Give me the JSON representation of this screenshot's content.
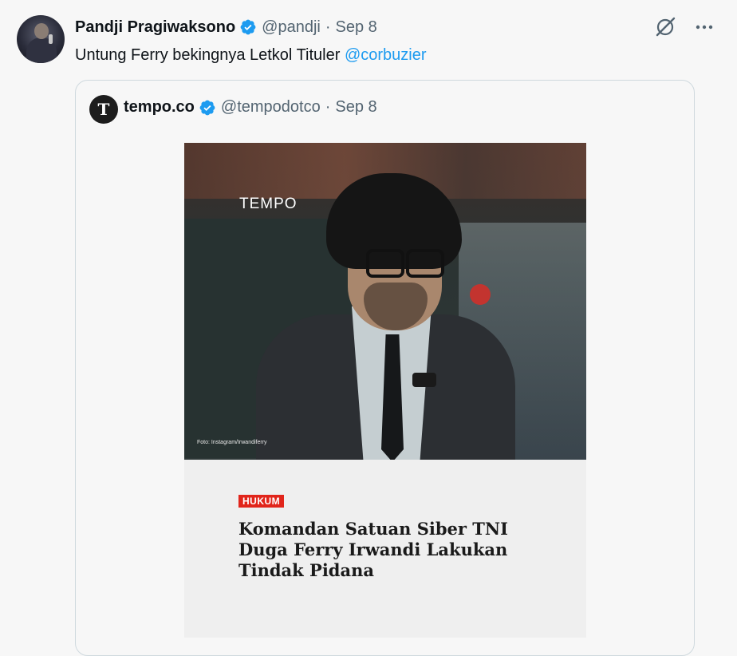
{
  "tweet": {
    "author_name": "Pandji Pragiwaksono",
    "handle": "@pandji",
    "separator": "·",
    "date": "Sep 8",
    "text_before": "Untung Ferry bekingnya Letkol Tituler ",
    "mention": "@corbuzier",
    "icons": {
      "verified": "verified-badge-icon",
      "grok": "grok-icon",
      "more": "more-icon"
    }
  },
  "quote": {
    "avatar_letter": "T",
    "author_name": "tempo.co",
    "handle": "@tempodotco",
    "separator": "·",
    "date": "Sep 8",
    "image": {
      "wordmark": "TEMPO",
      "credit": "Foto: Instagram/Irwandiferry",
      "category": "HUKUM",
      "headline_lines": [
        "Komandan Satuan Siber TNI",
        "Duga Ferry Irwandi Lakukan",
        "Tindak Pidana"
      ]
    }
  },
  "colors": {
    "accent": "#1d9bf0",
    "text": "#0f1419",
    "muted": "#536471",
    "category_bg": "#e1251b"
  }
}
